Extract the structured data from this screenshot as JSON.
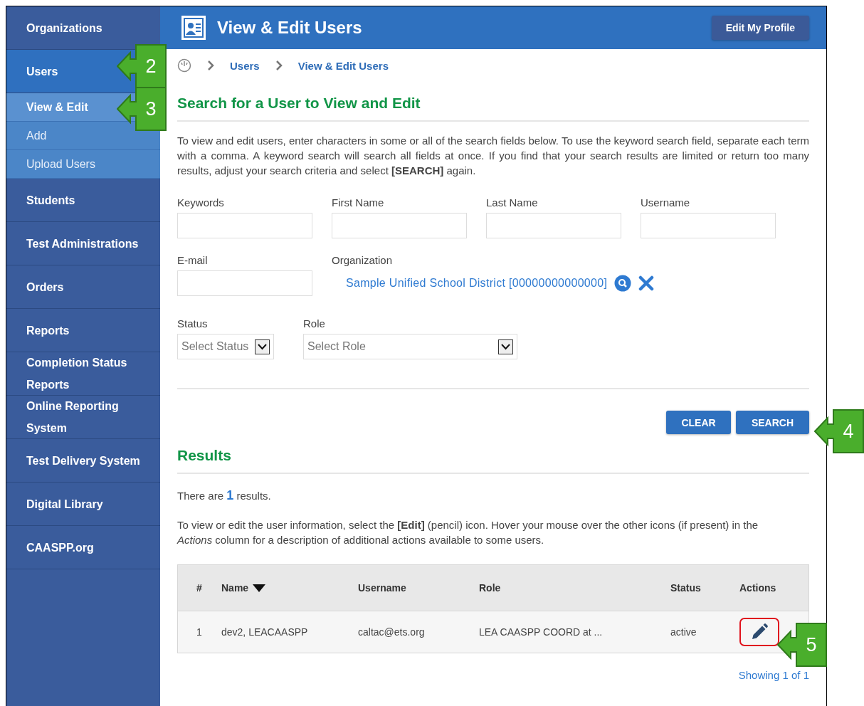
{
  "sidebar": {
    "items": [
      {
        "label": "Organizations",
        "selected": false
      },
      {
        "label": "Users",
        "selected": true,
        "children": [
          {
            "label": "View & Edit",
            "selected": true
          },
          {
            "label": "Add",
            "selected": false
          },
          {
            "label": "Upload Users",
            "selected": false
          }
        ]
      },
      {
        "label": "Students",
        "selected": false
      },
      {
        "label": "Test Administrations",
        "selected": false
      },
      {
        "label": "Orders",
        "selected": false
      },
      {
        "label": "Reports",
        "selected": false
      },
      {
        "label": "Completion Status Reports",
        "selected": false
      },
      {
        "label": "Online Reporting System",
        "selected": false
      },
      {
        "label": "Test Delivery System",
        "selected": false
      },
      {
        "label": "Digital Library",
        "selected": false
      },
      {
        "label": "CAASPP.org",
        "selected": false
      }
    ]
  },
  "header": {
    "title": "View & Edit Users",
    "profile_button": "Edit My Profile"
  },
  "breadcrumb": [
    "Users",
    "View & Edit Users"
  ],
  "search": {
    "heading": "Search for a User to View and Edit",
    "intro": "To view and edit users, enter characters in some or all of the search fields below. To use the keyword search field, separate each term with a comma. A keyword search will search all fields at once. If you find that your search results are limited or return too many results, adjust your search criteria and select **[SEARCH]** again.",
    "fields": [
      {
        "label": "Keywords"
      },
      {
        "label": "First Name"
      },
      {
        "label": "Last Name"
      },
      {
        "label": "Username"
      }
    ],
    "email": {
      "label": "E-mail"
    },
    "organization": {
      "label": "Organization",
      "value": "Sample Unified School District [00000000000000]"
    },
    "status": {
      "label": "Status",
      "placeholder": "Select Status"
    },
    "role": {
      "label": "Role",
      "placeholder": "Select Role"
    },
    "buttons": [
      "CLEAR",
      "SEARCH"
    ]
  },
  "results": {
    "heading": "Results",
    "summary": "There are **1** results.",
    "instructions": "To view or edit the user information, select the **[Edit]** (pencil) icon. Hover your mouse over the other icons (if present) in the *Actions* column for a description of additional actions available to some users.",
    "table": {
      "columns": [
        "#",
        "Name",
        "Username",
        "Role",
        "Status",
        "Actions"
      ],
      "rows": [
        {
          "number": "1",
          "name": "dev2, LEACAASPP",
          "username": "caltac@ets.org",
          "role": "LEA CAASPP COORD at ...",
          "status": "active",
          "edit_highlighted": true
        }
      ]
    },
    "footer": "Showing 1 of 1"
  },
  "callouts": [
    {
      "label": "2"
    },
    {
      "label": "3"
    },
    {
      "label": "4"
    },
    {
      "label": "5"
    }
  ]
}
